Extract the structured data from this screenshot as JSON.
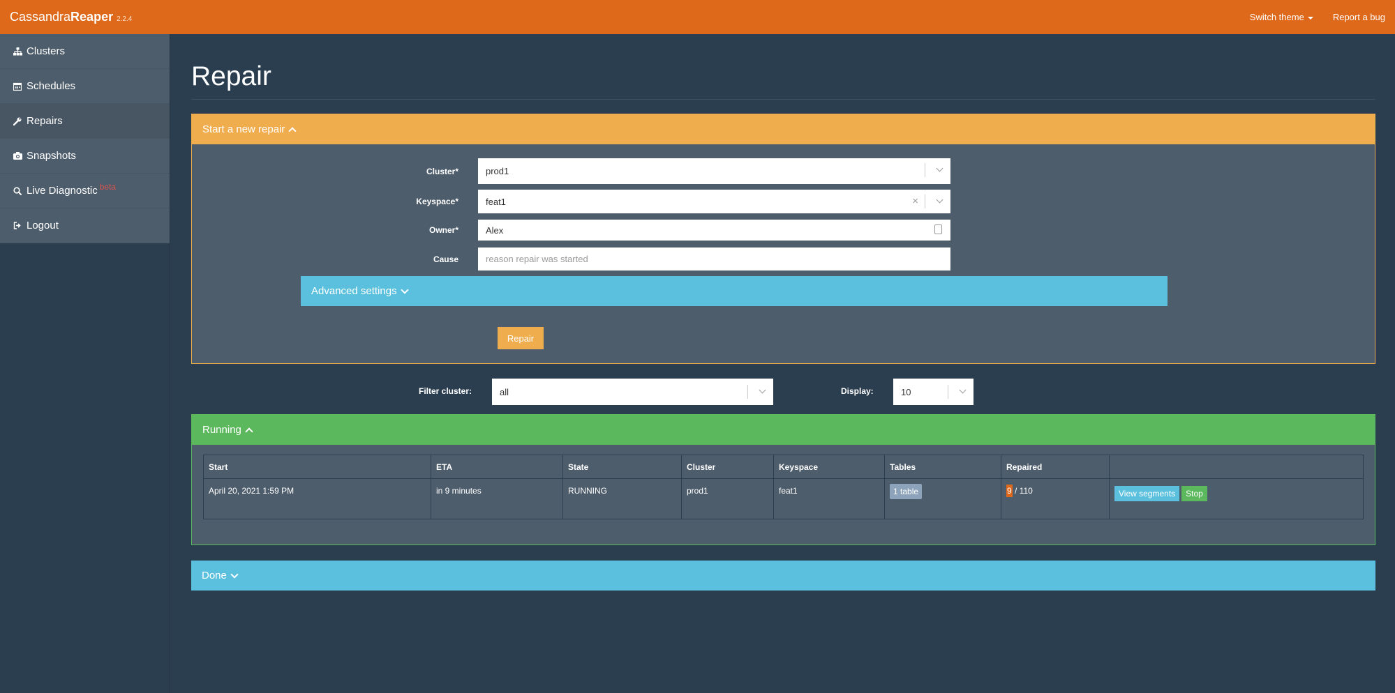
{
  "navbar": {
    "brand_thin": "Cassandra",
    "brand_bold": "Reaper",
    "version": "2.2.4",
    "switch_theme": "Switch theme",
    "report_bug": "Report a bug"
  },
  "sidebar": {
    "items": [
      {
        "label": "Clusters",
        "icon": "sitemap-icon"
      },
      {
        "label": "Schedules",
        "icon": "calendar-icon"
      },
      {
        "label": "Repairs",
        "icon": "wrench-icon"
      },
      {
        "label": "Snapshots",
        "icon": "camera-icon"
      },
      {
        "label": "Live Diagnostic",
        "icon": "search-icon",
        "badge": "beta"
      },
      {
        "label": "Logout",
        "icon": "logout-icon"
      }
    ],
    "active": "Repairs"
  },
  "page": {
    "title": "Repair"
  },
  "new_repair": {
    "heading": "Start a new repair",
    "cluster_label": "Cluster*",
    "cluster_value": "prod1",
    "keyspace_label": "Keyspace*",
    "keyspace_value": "feat1",
    "owner_label": "Owner*",
    "owner_value": "Alex",
    "cause_label": "Cause",
    "cause_placeholder": "reason repair was started",
    "advanced_label": "Advanced settings",
    "repair_button": "Repair"
  },
  "filters": {
    "filter_cluster_label": "Filter cluster:",
    "filter_cluster_value": "all",
    "display_label": "Display:",
    "display_value": "10"
  },
  "running": {
    "heading": "Running",
    "columns": [
      "Start",
      "ETA",
      "State",
      "Cluster",
      "Keyspace",
      "Tables",
      "Repaired",
      ""
    ],
    "rows": [
      {
        "start": "April 20, 2021 1:59 PM",
        "eta": "in 9 minutes",
        "state": "RUNNING",
        "cluster": "prod1",
        "keyspace": "feat1",
        "tables": "1 table",
        "repaired_done": "9",
        "repaired_total": "/ 110",
        "view_segments": "View segments",
        "stop": "Stop"
      }
    ]
  },
  "done": {
    "heading": "Done"
  },
  "colors": {
    "navbar": "#df691a",
    "background": "#2b3e50",
    "panel_body": "#4e5d6c",
    "warning": "#f0ad4e",
    "success": "#5cb85c",
    "info": "#5bc0de"
  }
}
